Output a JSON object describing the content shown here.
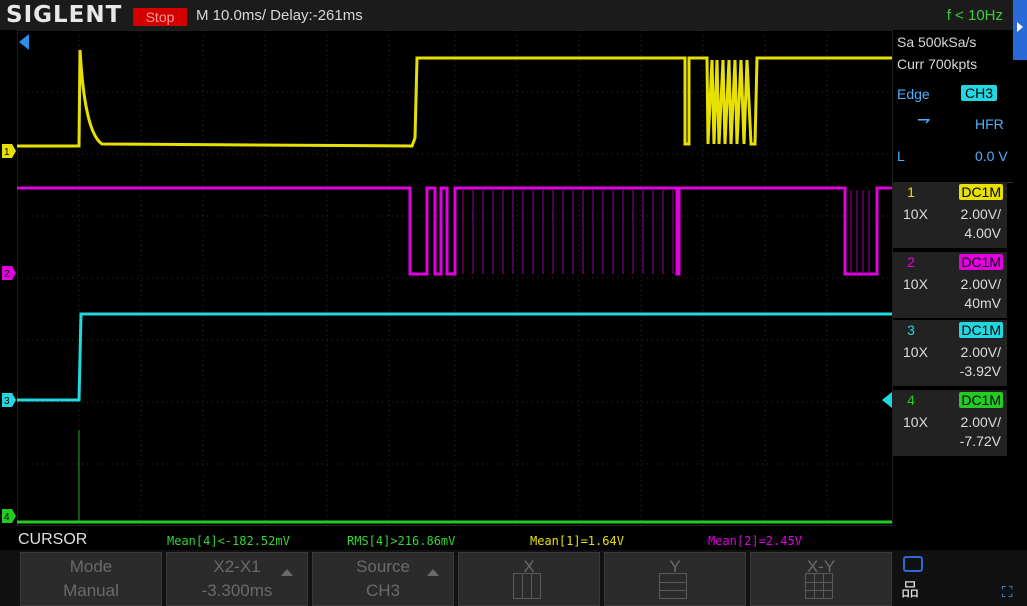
{
  "header": {
    "brand": "SIGLENT",
    "run_state": "Stop",
    "timebase": "M 10.0ms/ Delay:-261ms",
    "trigger_freq": "f < 10Hz"
  },
  "acquisition": {
    "sample_rate": "Sa 500kSa/s",
    "memory": "Curr 700kpts"
  },
  "trigger": {
    "type": "Edge",
    "source": "CH3",
    "slope_icon": "falling-edge-icon",
    "coupling": "HFR",
    "mode": "L",
    "level": "0.0 V"
  },
  "channels": [
    {
      "num": "1",
      "coupling": "DC1M",
      "probe": "10X",
      "scale": "2.00V/",
      "offset": "4.00V",
      "color": "#e8e000"
    },
    {
      "num": "2",
      "coupling": "DC1M",
      "probe": "10X",
      "scale": "2.00V/",
      "offset": "40mV",
      "color": "#e000e0"
    },
    {
      "num": "3",
      "coupling": "DC1M",
      "probe": "10X",
      "scale": "2.00V/",
      "offset": "-3.92V",
      "color": "#22d8e0"
    },
    {
      "num": "4",
      "coupling": "DC1M",
      "probe": "10X",
      "scale": "2.00V/",
      "offset": "-7.72V",
      "color": "#22cc22"
    }
  ],
  "channel_markers": [
    "1",
    "2",
    "3",
    "4"
  ],
  "cursor": {
    "label": "CURSOR",
    "mean4": "Mean[4]<-182.52mV",
    "rms4": "RMS[4]>216.86mV",
    "mean1": "Mean[1]=1.64V",
    "mean2": "Mean[2]=2.45V"
  },
  "softkeys": {
    "mode": {
      "label": "Mode",
      "value": "Manual"
    },
    "x2x1": {
      "label": "X2-X1",
      "value": "-3.300ms"
    },
    "source": {
      "label": "Source",
      "value": "CH3"
    },
    "x": {
      "label": "X"
    },
    "y": {
      "label": "Y"
    },
    "xy": {
      "label": "X-Y"
    }
  },
  "icons": [
    "usb-icon",
    "network-icon",
    "expand-icon",
    "trigger-position-icon",
    "trigger-level-icon"
  ]
}
